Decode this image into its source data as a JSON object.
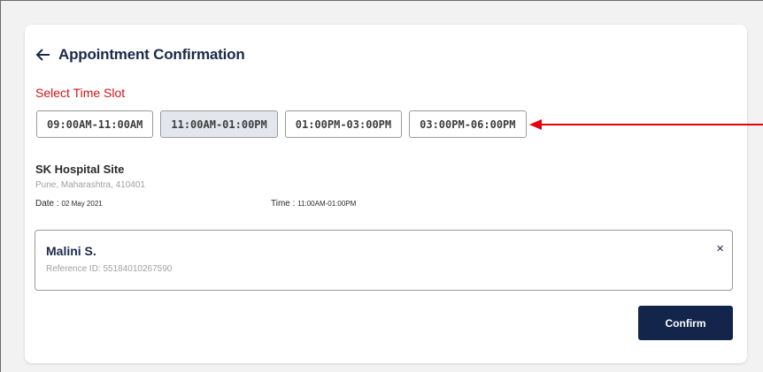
{
  "header": {
    "title": "Appointment Confirmation",
    "back_icon": "arrow-left-icon"
  },
  "time_slot": {
    "label": "Select Time Slot",
    "slots": [
      {
        "label": "09:00AM-11:00AM",
        "selected": false
      },
      {
        "label": "11:00AM-01:00PM",
        "selected": true
      },
      {
        "label": "01:00PM-03:00PM",
        "selected": false
      },
      {
        "label": "03:00PM-06:00PM",
        "selected": false
      }
    ]
  },
  "site": {
    "name": "SK Hospital Site",
    "address": "Pune, Maharashtra, 410401",
    "date_label": "Date : ",
    "date_value": "02 May 2021",
    "time_label": "Time : ",
    "time_value": "11:00AM-01:00PM"
  },
  "patient": {
    "name": "Malini S.",
    "reference": "Reference ID: 55184010267590",
    "close_symbol": "×"
  },
  "actions": {
    "confirm_label": "Confirm"
  },
  "colors": {
    "accent_red": "#d0141a",
    "navy": "#13254b",
    "selected_slot_bg": "#e3e6ed",
    "annotation_arrow": "#e3000f"
  }
}
